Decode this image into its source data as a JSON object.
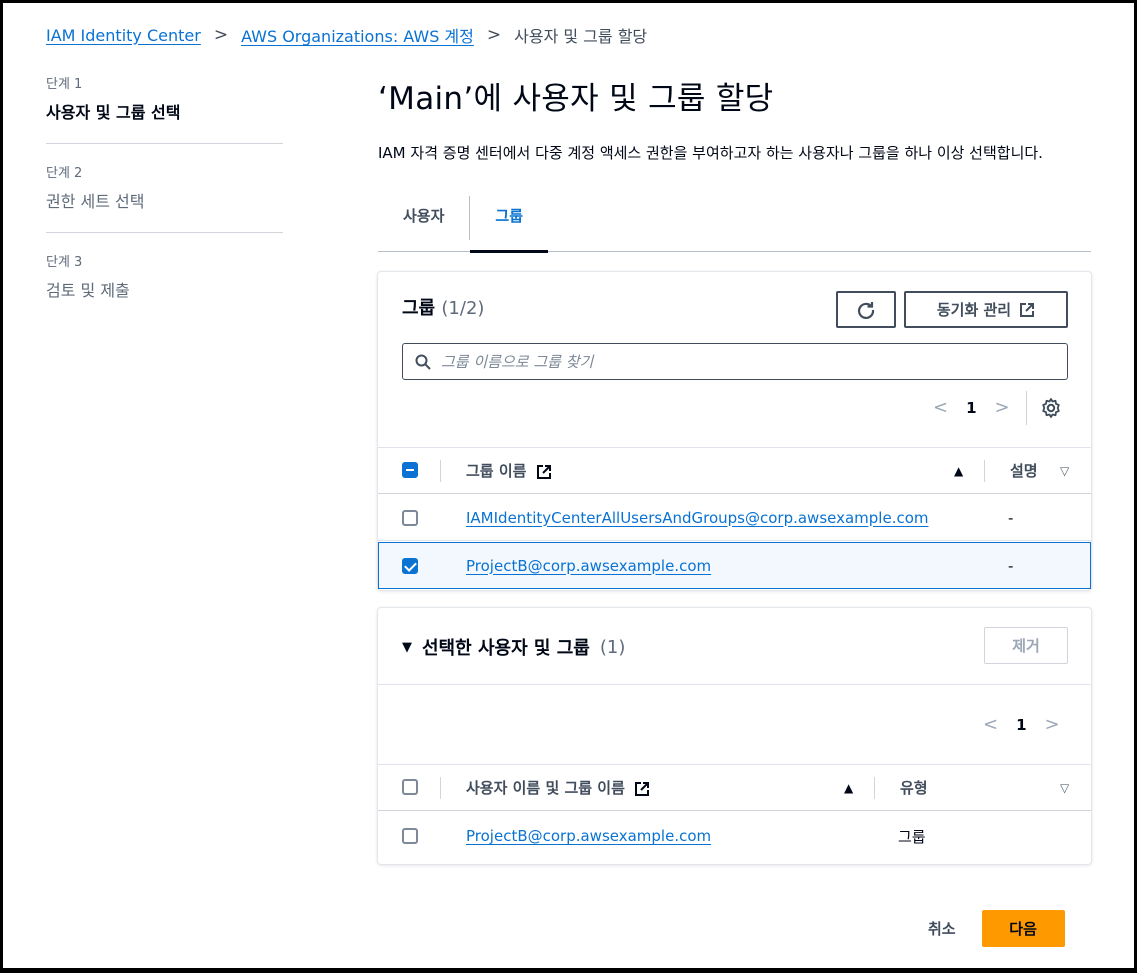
{
  "breadcrumb": {
    "items": [
      "IAM Identity Center",
      "AWS Organizations: AWS 계정"
    ],
    "current": "사용자 및 그룹 할당"
  },
  "steps": [
    {
      "num": "단계 1",
      "label": "사용자 및 그룹 선택",
      "active": true
    },
    {
      "num": "단계 2",
      "label": "권한 세트 선택",
      "active": false
    },
    {
      "num": "단계 3",
      "label": "검토 및 제출",
      "active": false
    }
  ],
  "page": {
    "title": "‘Main’에 사용자 및 그룹 할당",
    "description": "IAM 자격 증명 센터에서 다중 계정 액세스 권한을 부여하고자 하는 사용자나 그룹을 하나 이상 선택합니다."
  },
  "tabs": [
    {
      "label": "사용자",
      "active": false
    },
    {
      "label": "그룹",
      "active": true
    }
  ],
  "groups_panel": {
    "title": "그룹",
    "count": "(1/2)",
    "sync_label": "동기화 관리",
    "search_placeholder": "그룹 이름으로 그룹 찾기",
    "page_number": "1",
    "columns": {
      "name": "그룹 이름",
      "description": "설명"
    },
    "rows": [
      {
        "name": "IAMIdentityCenterAllUsersAndGroups@corp.awsexample.com",
        "description": "-",
        "selected": false
      },
      {
        "name": "ProjectB@corp.awsexample.com",
        "description": "-",
        "selected": true
      }
    ]
  },
  "selected_panel": {
    "title": "선택한 사용자 및 그룹",
    "count": "(1)",
    "remove_label": "제거",
    "page_number": "1",
    "columns": {
      "name": "사용자 이름 및 그룹 이름",
      "type": "유형"
    },
    "rows": [
      {
        "name": "ProjectB@corp.awsexample.com",
        "type": "그룹"
      }
    ]
  },
  "footer": {
    "cancel_label": "취소",
    "next_label": "다음"
  },
  "colors": {
    "link": "#0972d3",
    "primary_button": "#ff9900",
    "selected_row_bg": "#f2f8fd"
  }
}
